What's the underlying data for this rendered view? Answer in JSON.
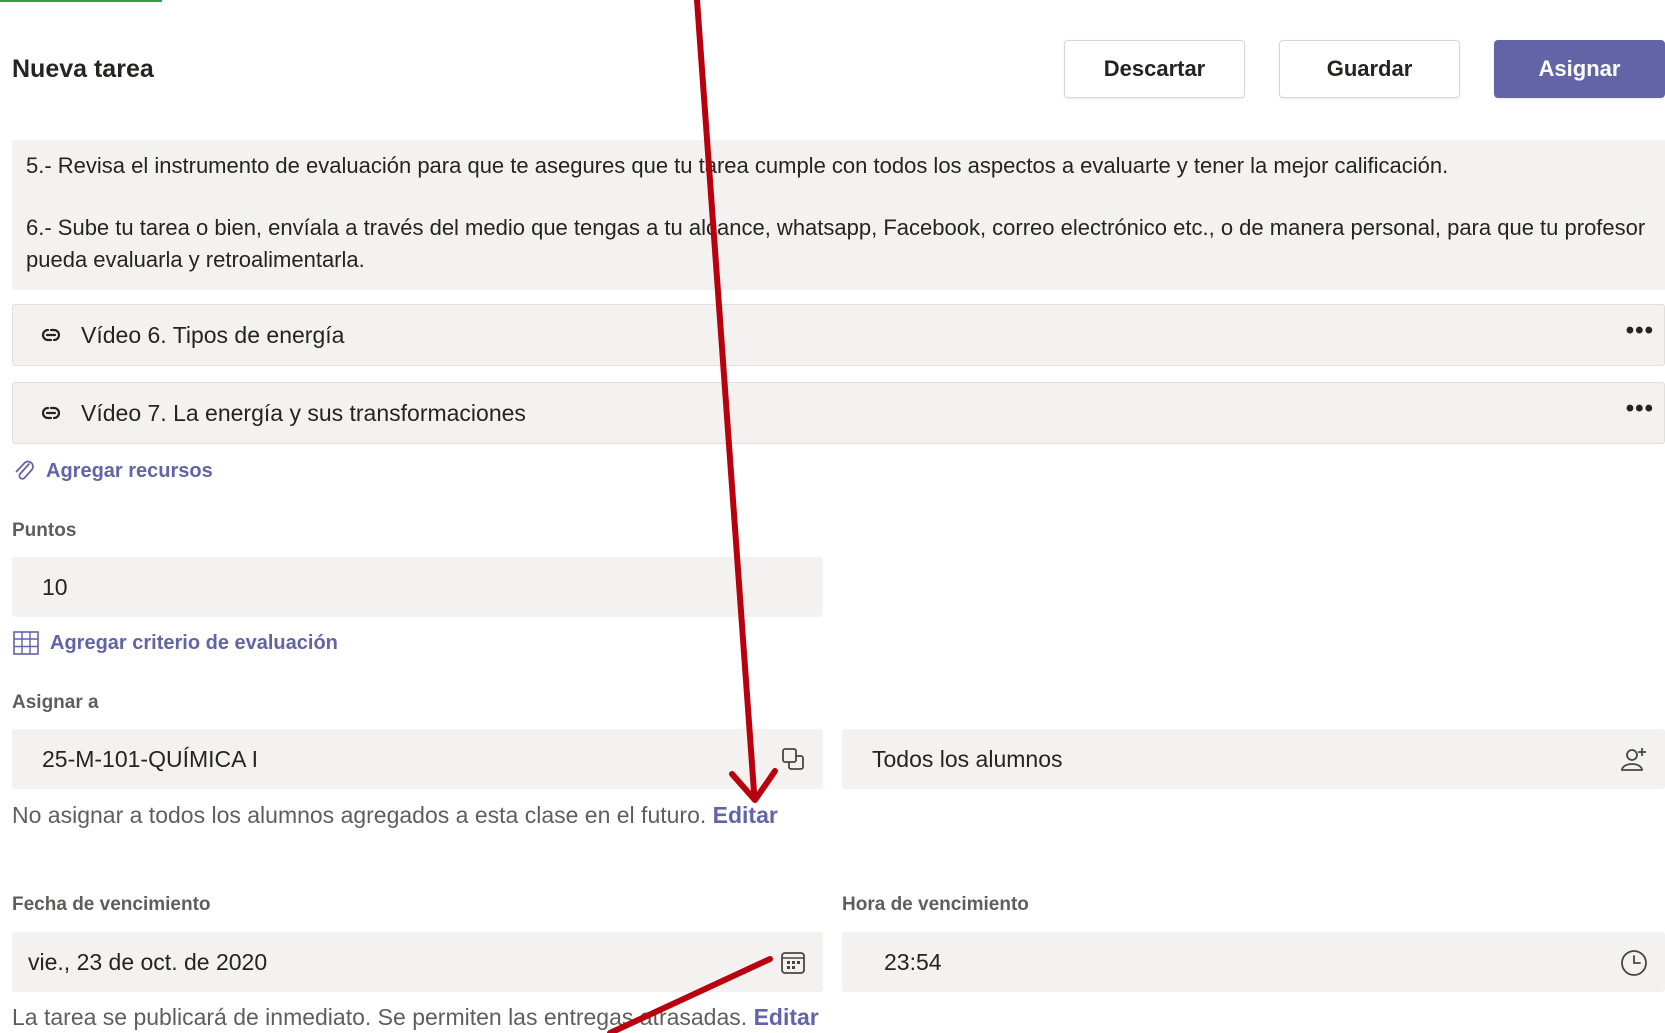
{
  "header": {
    "title": "Nueva tarea",
    "discard_label": "Descartar",
    "save_label": "Guardar",
    "assign_label": "Asignar"
  },
  "instructions": {
    "line5": "5.- Revisa el instrumento de evaluación para que te asegures que tu tarea cumple con todos los aspectos a evaluarte y tener la mejor calificación.",
    "line6": "6.- Sube tu tarea o bien, envíala a través del medio que tengas a tu alcance, whatsapp, Facebook, correo electrónico etc., o de manera personal, para que tu profesor  pueda evaluarla y retroalimentarla."
  },
  "resources": [
    {
      "label": "Vídeo 6. Tipos de energía",
      "icon": "link-icon",
      "more": "•••"
    },
    {
      "label": "Vídeo 7. La energía y sus transformaciones",
      "icon": "link-icon",
      "more": "•••"
    }
  ],
  "add_resources_label": "Agregar recursos",
  "points": {
    "label": "Puntos",
    "value": "10"
  },
  "add_rubric_label": "Agregar criterio de evaluación",
  "assign_to": {
    "label": "Asignar a",
    "class_value": "25-M-101-QUÍMICA I",
    "students_value": "Todos los alumnos",
    "note": "No asignar a todos los alumnos agregados a esta clase en el futuro.",
    "edit_label": "Editar"
  },
  "due_date": {
    "label": "Fecha de vencimiento",
    "value": "vie., 23 de oct. de 2020"
  },
  "due_time": {
    "label": "Hora de vencimiento",
    "value": "23:54"
  },
  "publish_note": {
    "text": "La tarea se publicará de inmediato. Se permiten las entregas atrasadas.",
    "edit_label": "Editar"
  },
  "colors": {
    "accent": "#6264a7",
    "annotation_arrow": "#b8000f",
    "field_bg": "#f3f2f1"
  }
}
